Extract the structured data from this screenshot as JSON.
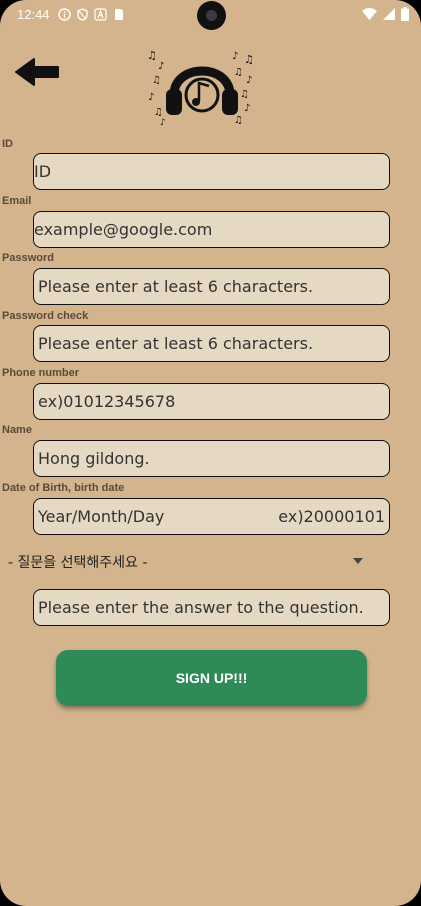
{
  "status_bar": {
    "time": "12:44"
  },
  "form": {
    "fields": [
      {
        "label": "ID",
        "value": "ID"
      },
      {
        "label": "Email",
        "value": "example@google.com"
      },
      {
        "label": "Password",
        "value": "Please enter at least 6 characters."
      },
      {
        "label": "Password check",
        "value": "Please enter at least 6 characters."
      },
      {
        "label": "Phone number",
        "value": "ex)01012345678"
      },
      {
        "label": "Name",
        "value": "Hong gildong."
      },
      {
        "label": "Date of Birth, birth date",
        "value": "Year/Month/Day",
        "hint": "ex)20000101"
      }
    ],
    "question_select": "- 질문을 선택해주세요 -",
    "answer_placeholder": "Please enter the answer to the question.",
    "submit_label": "SIGN UP!!!"
  },
  "colors": {
    "background": "#d4b48c",
    "field_background": "#e6d9c3",
    "button": "#2e8b57"
  },
  "icons": {
    "back": "arrow-left-icon",
    "logo": "headphones-music-icon"
  }
}
